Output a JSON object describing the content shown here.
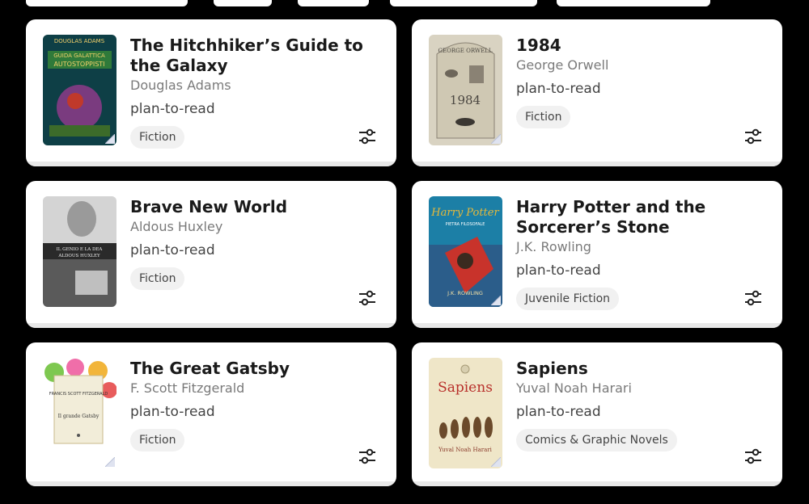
{
  "books": [
    {
      "title": "The Hitchhiker’s Guide to the Galaxy",
      "author": "Douglas Adams",
      "status": "plan-to-read",
      "genre": "Fiction",
      "cover_text": [
        "DOUGLAS ADAMS",
        "GUIDA GALATTICA",
        "AUTOSTOPPISTI"
      ],
      "cover_colors": [
        "#0e3f46",
        "#7a3b7f"
      ]
    },
    {
      "title": "1984",
      "author": "George Orwell",
      "status": "plan-to-read",
      "genre": "Fiction",
      "cover_text": [
        "GEORGE ORWELL",
        "1984"
      ],
      "cover_colors": [
        "#d9d3c2",
        "#8a8274"
      ]
    },
    {
      "title": "Brave New World",
      "author": "Aldous Huxley",
      "status": "plan-to-read",
      "genre": "Fiction",
      "cover_text": [
        "IL GENIO E LA DEA",
        "ALDOUS HUXLEY"
      ],
      "cover_colors": [
        "#e9e9e9",
        "#2a2a2a"
      ]
    },
    {
      "title": "Harry Potter and the Sorcerer’s Stone",
      "author": "J.K. Rowling",
      "status": "plan-to-read",
      "genre": "Juvenile Fiction",
      "cover_text": [
        "Harry Potter",
        "PIETRA FILOSOFALE",
        "J.K. ROWLING"
      ],
      "cover_colors": [
        "#1c7fa6",
        "#c8332b"
      ]
    },
    {
      "title": "The Great Gatsby",
      "author": "F. Scott Fitzgerald",
      "status": "plan-to-read",
      "genre": "Fiction",
      "cover_text": [
        "FRANCIS SCOTT FITZGERALD",
        "Il grande Gatsby"
      ],
      "cover_colors": [
        "#f2edd9",
        "#c8b98a"
      ]
    },
    {
      "title": "Sapiens",
      "author": "Yuval Noah Harari",
      "status": "plan-to-read",
      "genre": "Comics & Graphic Novels",
      "cover_text": [
        "Sapiens",
        "Yuval Noah Harari"
      ],
      "cover_colors": [
        "#efe6c8",
        "#b8302b"
      ]
    }
  ],
  "icons": {
    "adjust": "sliders-icon",
    "page_curl": "page-curl-icon"
  }
}
